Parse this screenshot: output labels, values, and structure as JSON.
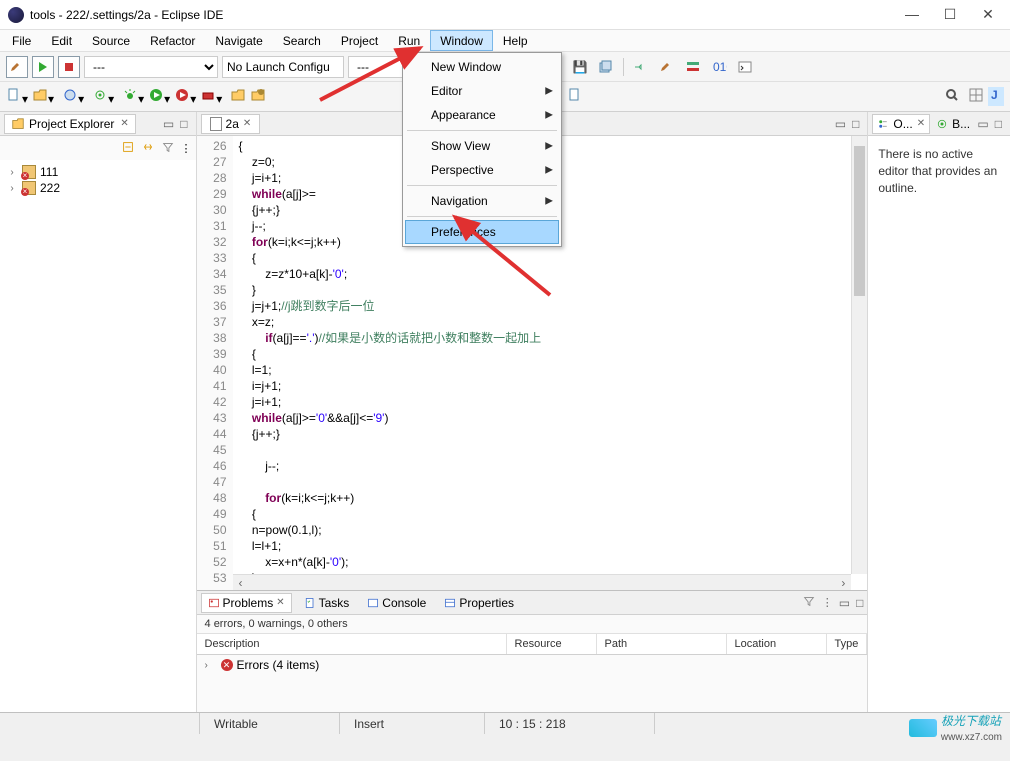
{
  "window": {
    "title": "tools - 222/.settings/2a - Eclipse IDE",
    "min": "—",
    "max": "☐",
    "close": "✕"
  },
  "menubar": [
    "File",
    "Edit",
    "Source",
    "Refactor",
    "Navigate",
    "Search",
    "Project",
    "Run",
    "Window",
    "Help"
  ],
  "activeMenu": "Window",
  "dropdown": {
    "items": [
      {
        "label": "New Window"
      },
      {
        "label": "Editor",
        "sub": true
      },
      {
        "label": "Appearance",
        "sub": true
      },
      {
        "sep": true
      },
      {
        "label": "Show View",
        "sub": true
      },
      {
        "label": "Perspective",
        "sub": true
      },
      {
        "sep": true
      },
      {
        "label": "Navigation",
        "sub": true
      },
      {
        "sep": true
      },
      {
        "label": "Preferences",
        "hover": true
      }
    ]
  },
  "toolbar": {
    "launchConfig": "No Launch Configu",
    "runOn": "---",
    "target": "---"
  },
  "projectExplorer": {
    "title": "Project Explorer",
    "nodes": [
      {
        "label": "111"
      },
      {
        "label": "222"
      }
    ]
  },
  "editor": {
    "tabLabel": "2a",
    "startLine": 26,
    "lines": [
      "{",
      "    z=0;",
      "    j=i+1;",
      "    while(a[j]>=",
      "    {j++;}",
      "    j--;",
      "    for(k=i;k<=j;k++)",
      "    {",
      "        z=z*10+a[k]-'0';",
      "    }",
      "    j=j+1;//j跳到数字后一位",
      "    x=z;",
      "        if(a[j]=='.')//如果是小数的话就把小数和整数一起加上",
      "    {",
      "    l=1;",
      "    i=j+1;",
      "    j=i+1;",
      "    while(a[j]>='0'&&a[j]<='9')",
      "    {j++;}",
      "",
      "        j--;",
      "",
      "        for(k=i;k<=j;k++)",
      "    {",
      "    n=pow(0.1,l);",
      "    l=l+1;",
      "        x=x+n*(a[k]-'0');",
      "    }"
    ]
  },
  "outline": {
    "tab1": "O...",
    "tab2": "B...",
    "message": "There is no active editor that provides an outline."
  },
  "problems": {
    "tabs": [
      "Problems",
      "Tasks",
      "Console",
      "Properties"
    ],
    "summary": "4 errors, 0 warnings, 0 others",
    "columns": [
      "Description",
      "Resource",
      "Path",
      "Location",
      "Type"
    ],
    "row": "Errors (4 items)"
  },
  "statusbar": {
    "writable": "Writable",
    "insert": "Insert",
    "pos": "10 : 15 : 218"
  },
  "watermark": {
    "brand": "极光下载站",
    "url": "www.xz7.com"
  }
}
